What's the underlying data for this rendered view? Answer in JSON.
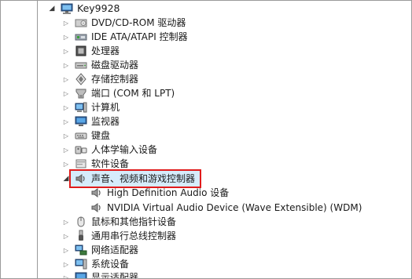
{
  "device_tree": {
    "computer_name": "Key9928",
    "categories": [
      {
        "label": "DVD/CD-ROM 驱动器",
        "icon": "dvd-drive-icon"
      },
      {
        "label": "IDE ATA/ATAPI 控制器",
        "icon": "ide-controller-icon"
      },
      {
        "label": "处理器",
        "icon": "processor-icon"
      },
      {
        "label": "磁盘驱动器",
        "icon": "disk-drive-icon"
      },
      {
        "label": "存储控制器",
        "icon": "storage-controller-icon"
      },
      {
        "label": "端口 (COM 和 LPT)",
        "icon": "port-icon"
      },
      {
        "label": "计算机",
        "icon": "computer-icon"
      },
      {
        "label": "监视器",
        "icon": "monitor-icon"
      },
      {
        "label": "键盘",
        "icon": "keyboard-icon"
      },
      {
        "label": "人体学输入设备",
        "icon": "hid-icon"
      },
      {
        "label": "软件设备",
        "icon": "software-device-icon"
      }
    ],
    "expanded_category": {
      "label": "声音、视频和游戏控制器",
      "icon": "sound-icon",
      "children": [
        {
          "label": "High Definition Audio 设备",
          "icon": "speaker-icon"
        },
        {
          "label": "NVIDIA Virtual Audio Device (Wave Extensible) (WDM)",
          "icon": "speaker-icon"
        }
      ]
    },
    "categories_after": [
      {
        "label": "鼠标和其他指针设备",
        "icon": "mouse-icon"
      },
      {
        "label": "通用串行总线控制器",
        "icon": "usb-icon"
      },
      {
        "label": "网络适配器",
        "icon": "network-adapter-icon"
      },
      {
        "label": "系统设备",
        "icon": "system-device-icon"
      },
      {
        "label": "显示适配器",
        "icon": "display-adapter-icon"
      }
    ]
  },
  "colors": {
    "highlight_border": "#e01b1b",
    "selection_fill": "#d6ecfb"
  }
}
